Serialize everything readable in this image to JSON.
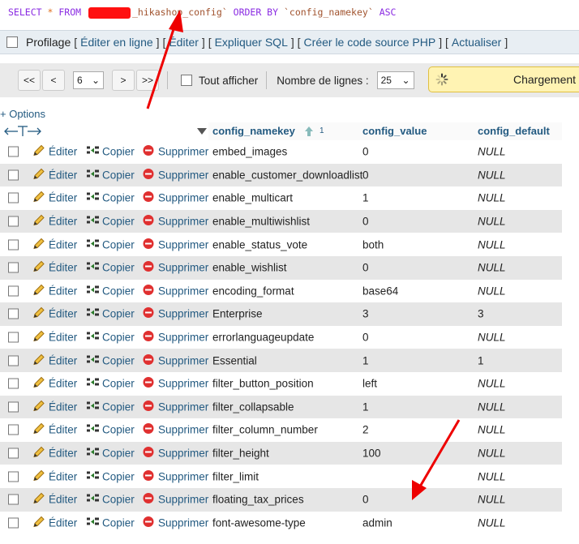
{
  "query": {
    "select": "SELECT",
    "star": "*",
    "from": "FROM",
    "table_suffix": "_hikashop_config`",
    "order": "ORDER BY",
    "order_col": "`config_namekey`",
    "dir": "ASC"
  },
  "links": {
    "profilage": "Profilage",
    "edit_inline": "Éditer en ligne",
    "edit": "Éditer",
    "explain": "Expliquer SQL",
    "create_code": "Créer le code source PHP",
    "refresh": "Actualiser"
  },
  "nav": {
    "first": "<<",
    "prev": "<",
    "page": "6",
    "next": ">",
    "last": ">>",
    "show_all": "Tout afficher",
    "rows_label": "Nombre de lignes :",
    "rows_value": "25",
    "loading": "Chargement e"
  },
  "options": "+ Options",
  "columns": {
    "namekey": "config_namekey",
    "sort_index": "1",
    "value": "config_value",
    "default": "config_default"
  },
  "actions": {
    "edit": "Éditer",
    "copy": "Copier",
    "delete": "Supprimer"
  },
  "rows": [
    {
      "key": "embed_images",
      "value": "0",
      "default": "NULL"
    },
    {
      "key": "enable_customer_downloadlist",
      "value": "0",
      "default": "NULL"
    },
    {
      "key": "enable_multicart",
      "value": "1",
      "default": "NULL"
    },
    {
      "key": "enable_multiwishlist",
      "value": "0",
      "default": "NULL"
    },
    {
      "key": "enable_status_vote",
      "value": "both",
      "default": "NULL"
    },
    {
      "key": "enable_wishlist",
      "value": "0",
      "default": "NULL"
    },
    {
      "key": "encoding_format",
      "value": "base64",
      "default": "NULL"
    },
    {
      "key": "Enterprise",
      "value": "3",
      "default": "3"
    },
    {
      "key": "errorlanguageupdate",
      "value": "0",
      "default": "NULL"
    },
    {
      "key": "Essential",
      "value": "1",
      "default": "1"
    },
    {
      "key": "filter_button_position",
      "value": "left",
      "default": "NULL"
    },
    {
      "key": "filter_collapsable",
      "value": "1",
      "default": "NULL"
    },
    {
      "key": "filter_column_number",
      "value": "2",
      "default": "NULL"
    },
    {
      "key": "filter_height",
      "value": "100",
      "default": "NULL"
    },
    {
      "key": "filter_limit",
      "value": "",
      "default": "NULL"
    },
    {
      "key": "floating_tax_prices",
      "value": "0",
      "default": "NULL"
    },
    {
      "key": "font-awesome-type",
      "value": "admin",
      "default": "NULL"
    }
  ]
}
